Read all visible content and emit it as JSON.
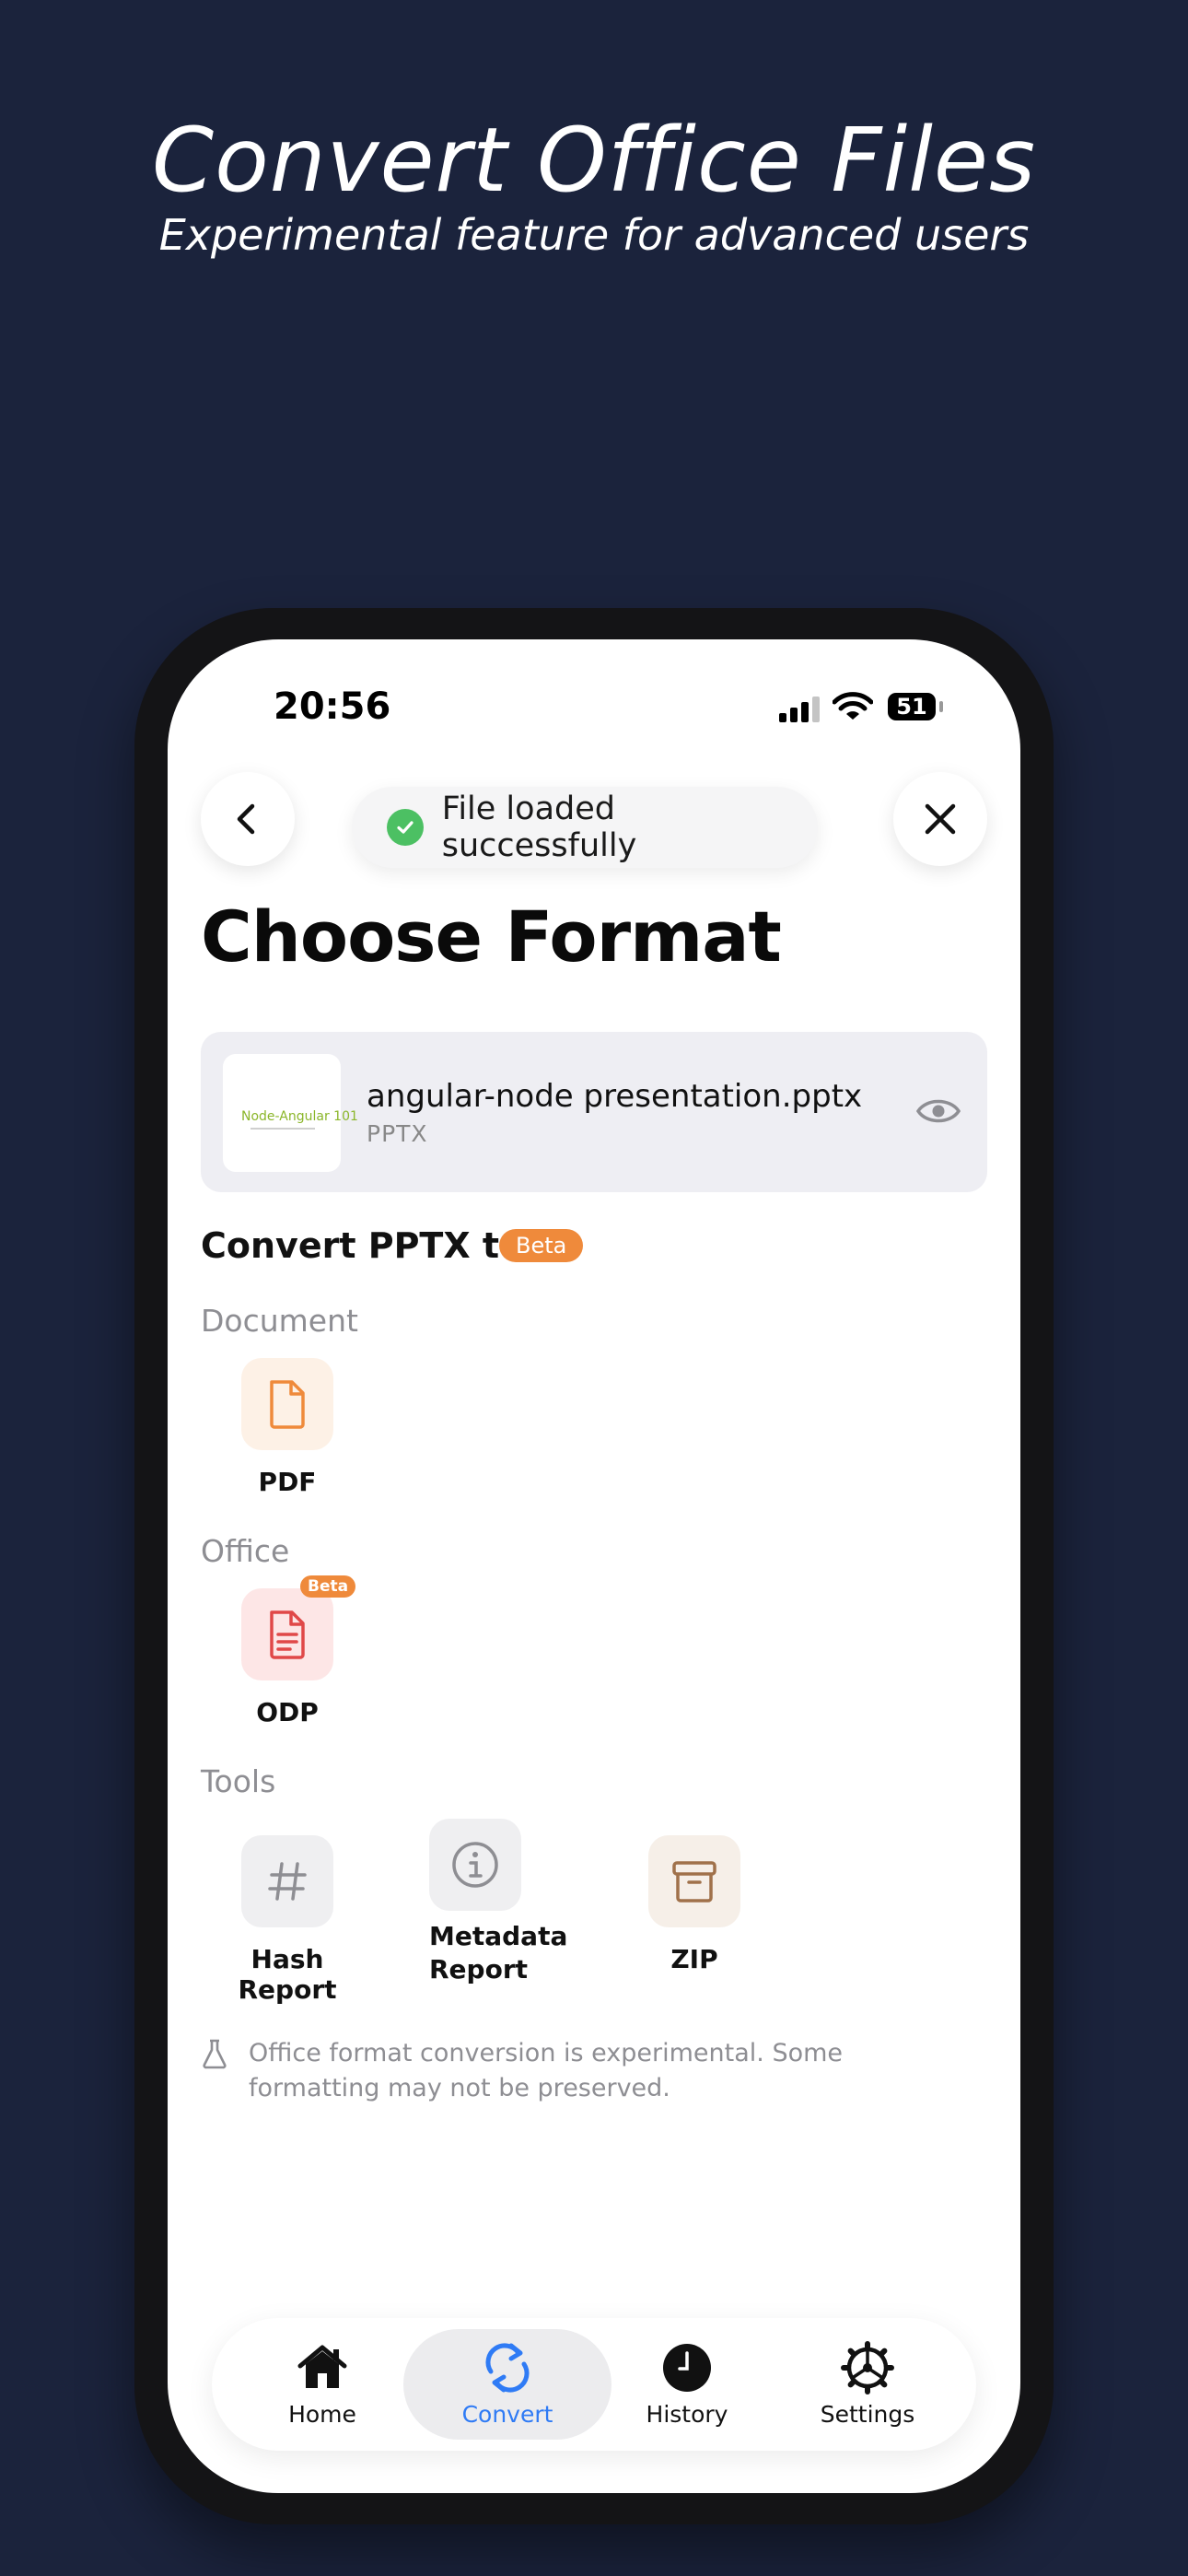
{
  "hero": {
    "title": "Convert Office Files",
    "subtitle": "Experimental feature for advanced users"
  },
  "status_bar": {
    "time": "20:56",
    "battery": "51"
  },
  "toast": {
    "text": "File loaded successfully"
  },
  "page": {
    "title": "Choose Format"
  },
  "file": {
    "name": "angular-node presentation.pptx",
    "type": "PPTX",
    "thumbnail_text": "Node-Angular 101"
  },
  "convert": {
    "heading": "Convert PPTX to:",
    "badge": "Beta"
  },
  "sections": {
    "document": {
      "label": "Document",
      "items": [
        {
          "label": "PDF",
          "icon": "file-icon"
        }
      ]
    },
    "office": {
      "label": "Office",
      "items": [
        {
          "label": "ODP",
          "icon": "document-text-icon",
          "badge": "Beta"
        }
      ]
    },
    "tools": {
      "label": "Tools",
      "items": [
        {
          "label": "Hash Report",
          "icon": "hash-icon"
        },
        {
          "label": "Metadata\nReport",
          "icon": "info-icon"
        },
        {
          "label": "ZIP",
          "icon": "archive-icon"
        }
      ]
    }
  },
  "note": "Office format conversion is experimental. Some formatting may not be preserved.",
  "tabs": [
    {
      "label": "Home",
      "icon": "home-icon"
    },
    {
      "label": "Convert",
      "icon": "convert-icon",
      "active": true
    },
    {
      "label": "History",
      "icon": "clock-icon"
    },
    {
      "label": "Settings",
      "icon": "gear-icon"
    }
  ],
  "colors": {
    "background": "#1b233c",
    "accent": "#2f7bf5",
    "beta": "#ef8a3b",
    "success": "#4cc063",
    "pdf_tint": "#fdf1e6",
    "odp_tint": "#fde6e6",
    "tool_tint": "#efeff1",
    "zip_tint": "#f6efe8"
  }
}
